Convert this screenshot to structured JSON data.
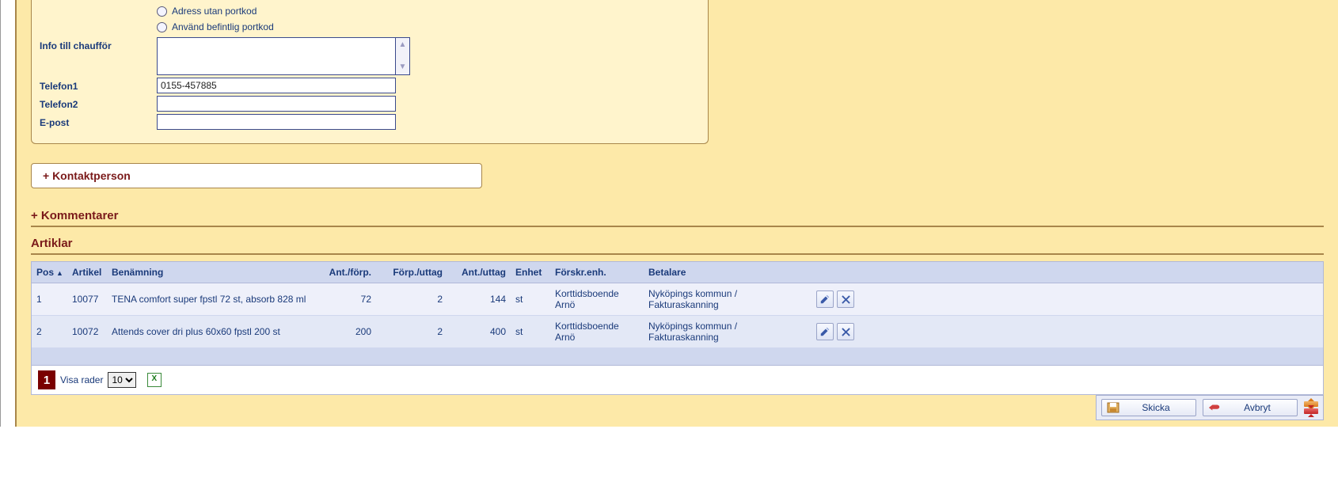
{
  "form": {
    "radio1_label": "Adress utan portkod",
    "radio2_label": "Använd befintlig portkod",
    "info_label": "Info till chaufför",
    "info_value": "",
    "tel1_label": "Telefon1",
    "tel1_value": "0155-457885",
    "tel2_label": "Telefon2",
    "tel2_value": "",
    "email_label": "E-post",
    "email_value": ""
  },
  "panels": {
    "contact": "+ Kontaktperson",
    "comments": "+ Kommentarer",
    "articles": "Artiklar"
  },
  "grid": {
    "headers": {
      "pos": "Pos",
      "art": "Artikel",
      "name": "Benämning",
      "aforp": "Ant./förp.",
      "futt": "Förp./uttag",
      "autt": "Ant./uttag",
      "unit": "Enhet",
      "presc": "Förskr.enh.",
      "pay": "Betalare"
    },
    "rows": [
      {
        "pos": "1",
        "art": "10077",
        "name": "TENA comfort super fpstl 72 st, absorb 828 ml",
        "aforp": "72",
        "futt": "2",
        "autt": "144",
        "unit": "st",
        "presc": "Korttidsboende Arnö",
        "pay": "Nyköpings kommun / Fakturaskanning"
      },
      {
        "pos": "2",
        "art": "10072",
        "name": "Attends cover dri plus 60x60 fpstl 200 st",
        "aforp": "200",
        "futt": "2",
        "autt": "400",
        "unit": "st",
        "presc": "Korttidsboende Arnö",
        "pay": "Nyköpings kommun / Fakturaskanning"
      }
    ],
    "footer": {
      "page": "1",
      "rows_label": "Visa rader",
      "rows_value": "10"
    }
  },
  "actions": {
    "send": "Skicka",
    "cancel": "Avbryt"
  }
}
